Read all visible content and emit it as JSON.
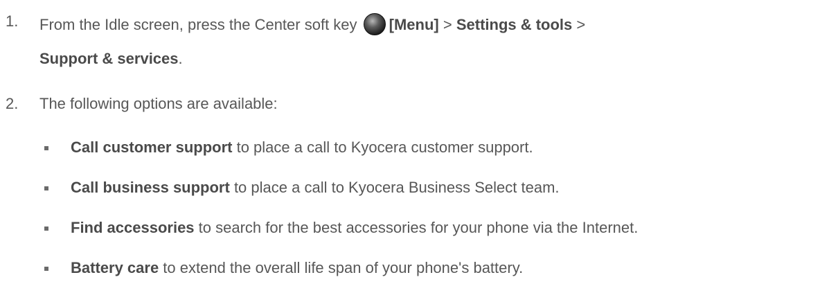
{
  "steps": [
    {
      "number": "1.",
      "line1_prefix": "From the Idle screen, press the Center soft key ",
      "menu_label": "[Menu]",
      "sep1": " > ",
      "settings_label": "Settings & tools",
      "sep2": " >",
      "support_label": "Support & services",
      "end": "."
    },
    {
      "number": "2.",
      "text": "The following options are available:"
    }
  ],
  "options": [
    {
      "label": "Call customer support",
      "desc": " to place a call to Kyocera customer support."
    },
    {
      "label": "Call business support",
      "desc": " to place a call to Kyocera Business Select team."
    },
    {
      "label": "Find accessories",
      "desc": " to search for the best accessories for your phone via the Internet."
    },
    {
      "label": "Battery care",
      "desc": " to extend the overall life span of your phone's battery."
    }
  ],
  "icons": {
    "center_soft_key": "center-soft-key-icon"
  }
}
